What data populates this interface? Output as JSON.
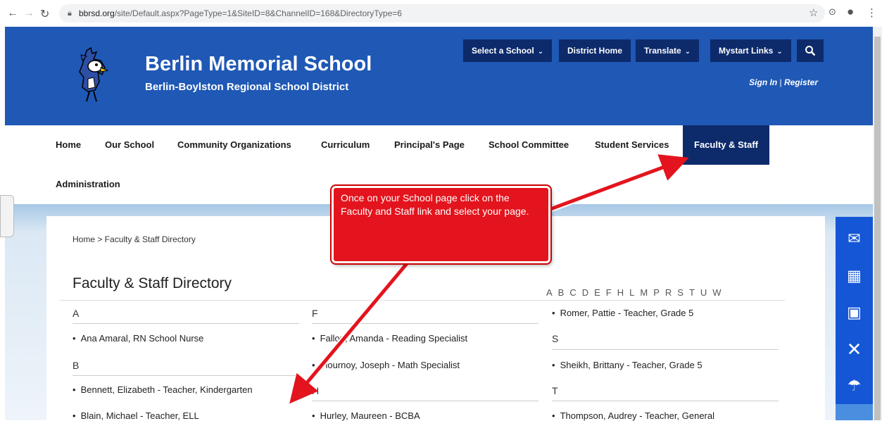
{
  "browser": {
    "url_domain": "bbrsd.org",
    "url_path": "/site/Default.aspx?PageType=1&SiteID=8&ChannelID=168&DirectoryType=6"
  },
  "header": {
    "school_name": "Berlin Memorial School",
    "district_name": "Berlin-Boylston Regional School District",
    "buttons": {
      "select_school": "Select a School",
      "district_home": "District Home",
      "translate": "Translate",
      "mystart": "Mystart Links"
    },
    "sign_in": "Sign In",
    "separator": "|",
    "register": "Register"
  },
  "nav": {
    "items": [
      "Home",
      "Our School",
      "Community Organizations",
      "Curriculum",
      "Principal's Page",
      "School Committee",
      "Student Services",
      "Faculty & Staff",
      "Administration"
    ],
    "active": "Faculty & Staff"
  },
  "breadcrumb": "Home > Faculty & Staff Directory",
  "directory": {
    "title": "Faculty & Staff Directory",
    "alphabet": [
      "A",
      "B",
      "C",
      "D",
      "E",
      "F",
      "H",
      "L",
      "M",
      "P",
      "R",
      "S",
      "T",
      "U",
      "W"
    ],
    "col1": {
      "A": "A",
      "a_entries": [
        "Ana Amaral, RN School Nurse"
      ],
      "B": "B",
      "b_entries": [
        "Bennett, Elizabeth - Teacher, Kindergarten",
        "Blain, Michael - Teacher, ELL"
      ]
    },
    "col2": {
      "F": "F",
      "f_entries": [
        "Fallon, Amanda - Reading Specialist",
        "Flournoy, Joseph - Math Specialist"
      ],
      "H": "H",
      "h_entries": [
        "Hurley, Maureen - BCBA"
      ]
    },
    "col3": {
      "r_entries": [
        "Romer, Pattie - Teacher, Grade 5"
      ],
      "S": "S",
      "s_entries": [
        "Sheikh, Brittany - Teacher, Grade 5"
      ],
      "T": "T",
      "t_entries": [
        "Thompson, Audrey - Teacher, General"
      ]
    }
  },
  "callout": {
    "text": "Once on your School page click on the Faculty and Staff link and select your  page."
  },
  "colors": {
    "header_blue": "#1f58b5",
    "dark_navy": "#0d2a6b",
    "callout_red": "#e3141d",
    "side_tool_blue": "#1556d6"
  },
  "icons": [
    "back-arrow-icon",
    "forward-arrow-icon",
    "reload-icon",
    "lock-icon",
    "star-icon",
    "extension-icon",
    "profile-icon",
    "menu-icon",
    "search-icon",
    "mail-icon",
    "calendar-icon",
    "contact-icon",
    "dining-icon",
    "umbrella-icon"
  ]
}
